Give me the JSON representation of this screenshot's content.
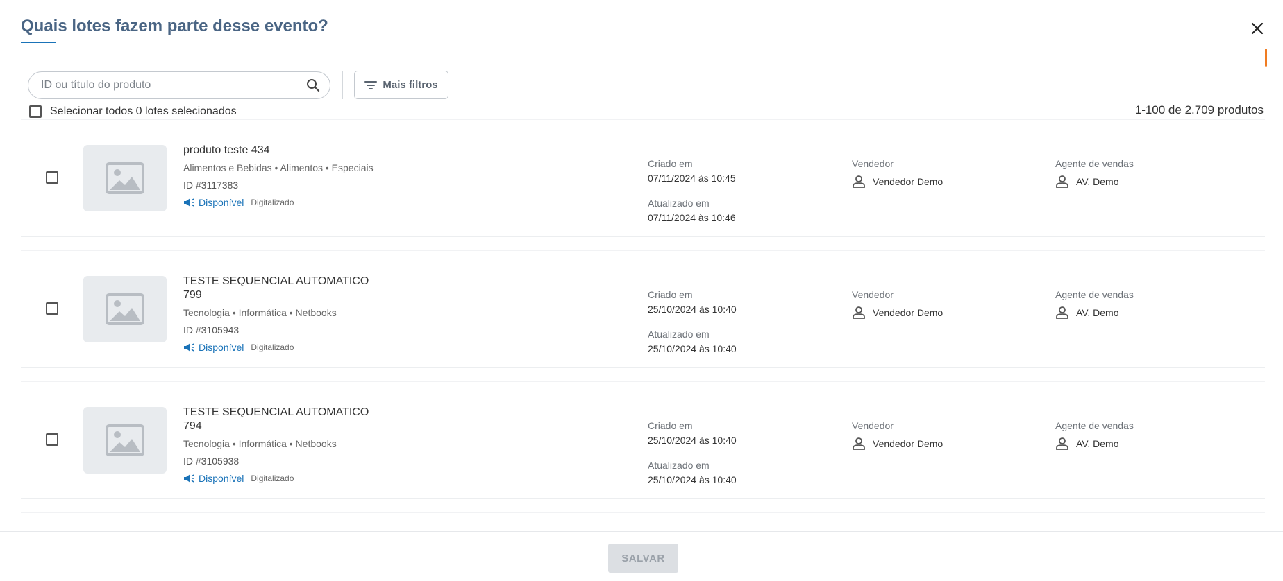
{
  "modal": {
    "title": "Quais lotes fazem parte desse evento?",
    "close_icon": "close-icon"
  },
  "search": {
    "placeholder": "ID ou título do produto",
    "value": ""
  },
  "filters": {
    "label": "Mais filtros"
  },
  "selection": {
    "label": "Selecionar todos 0 lotes selecionados",
    "checked": false
  },
  "results": {
    "count_label": "1-100 de 2.709 produtos"
  },
  "labels": {
    "created": "Criado em",
    "updated": "Atualizado em",
    "seller": "Vendedor",
    "agent": "Agente de vendas"
  },
  "products": [
    {
      "name": "produto teste 434",
      "category": "Alimentos e Bebidas • Alimentos • Especiais",
      "id": "ID #3117383",
      "status": "Disponível",
      "tag": "Digitalizado",
      "created": "07/11/2024 às 10:45",
      "updated": "07/11/2024 às 10:46",
      "seller": "Vendedor Demo",
      "agent": "AV. Demo"
    },
    {
      "name": "TESTE SEQUENCIAL AUTOMATICO 799",
      "category": "Tecnologia • Informática • Netbooks",
      "id": "ID #3105943",
      "status": "Disponível",
      "tag": "Digitalizado",
      "created": "25/10/2024 às 10:40",
      "updated": "25/10/2024 às 10:40",
      "seller": "Vendedor Demo",
      "agent": "AV. Demo"
    },
    {
      "name": "TESTE SEQUENCIAL AUTOMATICO 794",
      "category": "Tecnologia • Informática • Netbooks",
      "id": "ID #3105938",
      "status": "Disponível",
      "tag": "Digitalizado",
      "created": "25/10/2024 às 10:40",
      "updated": "25/10/2024 às 10:40",
      "seller": "Vendedor Demo",
      "agent": "AV. Demo"
    }
  ],
  "footer": {
    "save_label": "SALVAR"
  },
  "colors": {
    "title": "#4a6584",
    "accent": "#1a73b8",
    "scroll_indicator": "#f07c22",
    "disabled_button": "#dcdfe3"
  }
}
